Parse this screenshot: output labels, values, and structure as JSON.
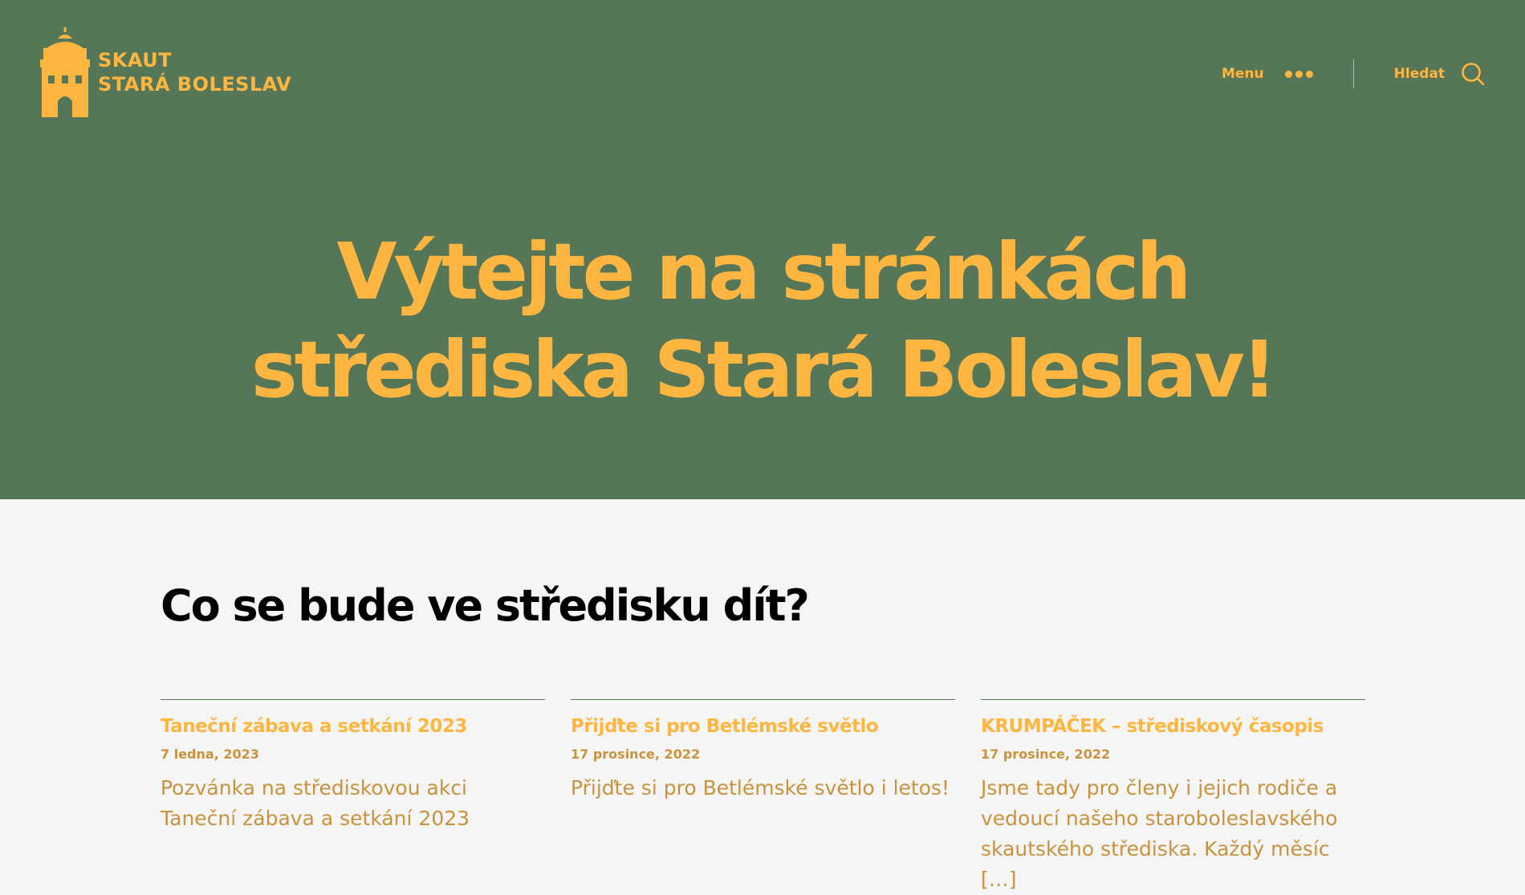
{
  "site": {
    "logo_line1": "SKAUT",
    "logo_line2": "STARÁ BOLESLAV"
  },
  "header": {
    "menu_label": "Menu",
    "search_label": "Hledat"
  },
  "hero": {
    "title_line1": "Výtejte na stránkách",
    "title_line2": "střediska Stará Boleslav!"
  },
  "section": {
    "title": "Co se bude ve středisku dít?"
  },
  "posts": [
    {
      "title": "Taneční zábava a setkání 2023",
      "date": "7 ledna, 2023",
      "excerpt": "Pozvánka na střediskovou akci Taneční zábava a setkání 2023"
    },
    {
      "title": "Přijďte si pro Betlémské světlo",
      "date": "17 prosince, 2022",
      "excerpt": "Přijďte si pro Betlémské světlo i letos!"
    },
    {
      "title": "KRUMPÁČEK – střediskový časopis",
      "date": "17 prosince, 2022",
      "excerpt": "Jsme tady pro členy i jejich rodiče a vedoucí našeho staroboleslavského skautského střediska. Každý měsíc […]"
    }
  ],
  "colors": {
    "hero_bg": "#567757",
    "accent": "#ffb641",
    "meta": "#c9933d",
    "page_bg": "#f4f5f4"
  },
  "icons": {
    "logo": "castle-tower-icon",
    "menu": "more-dots-icon",
    "search": "search-icon"
  }
}
